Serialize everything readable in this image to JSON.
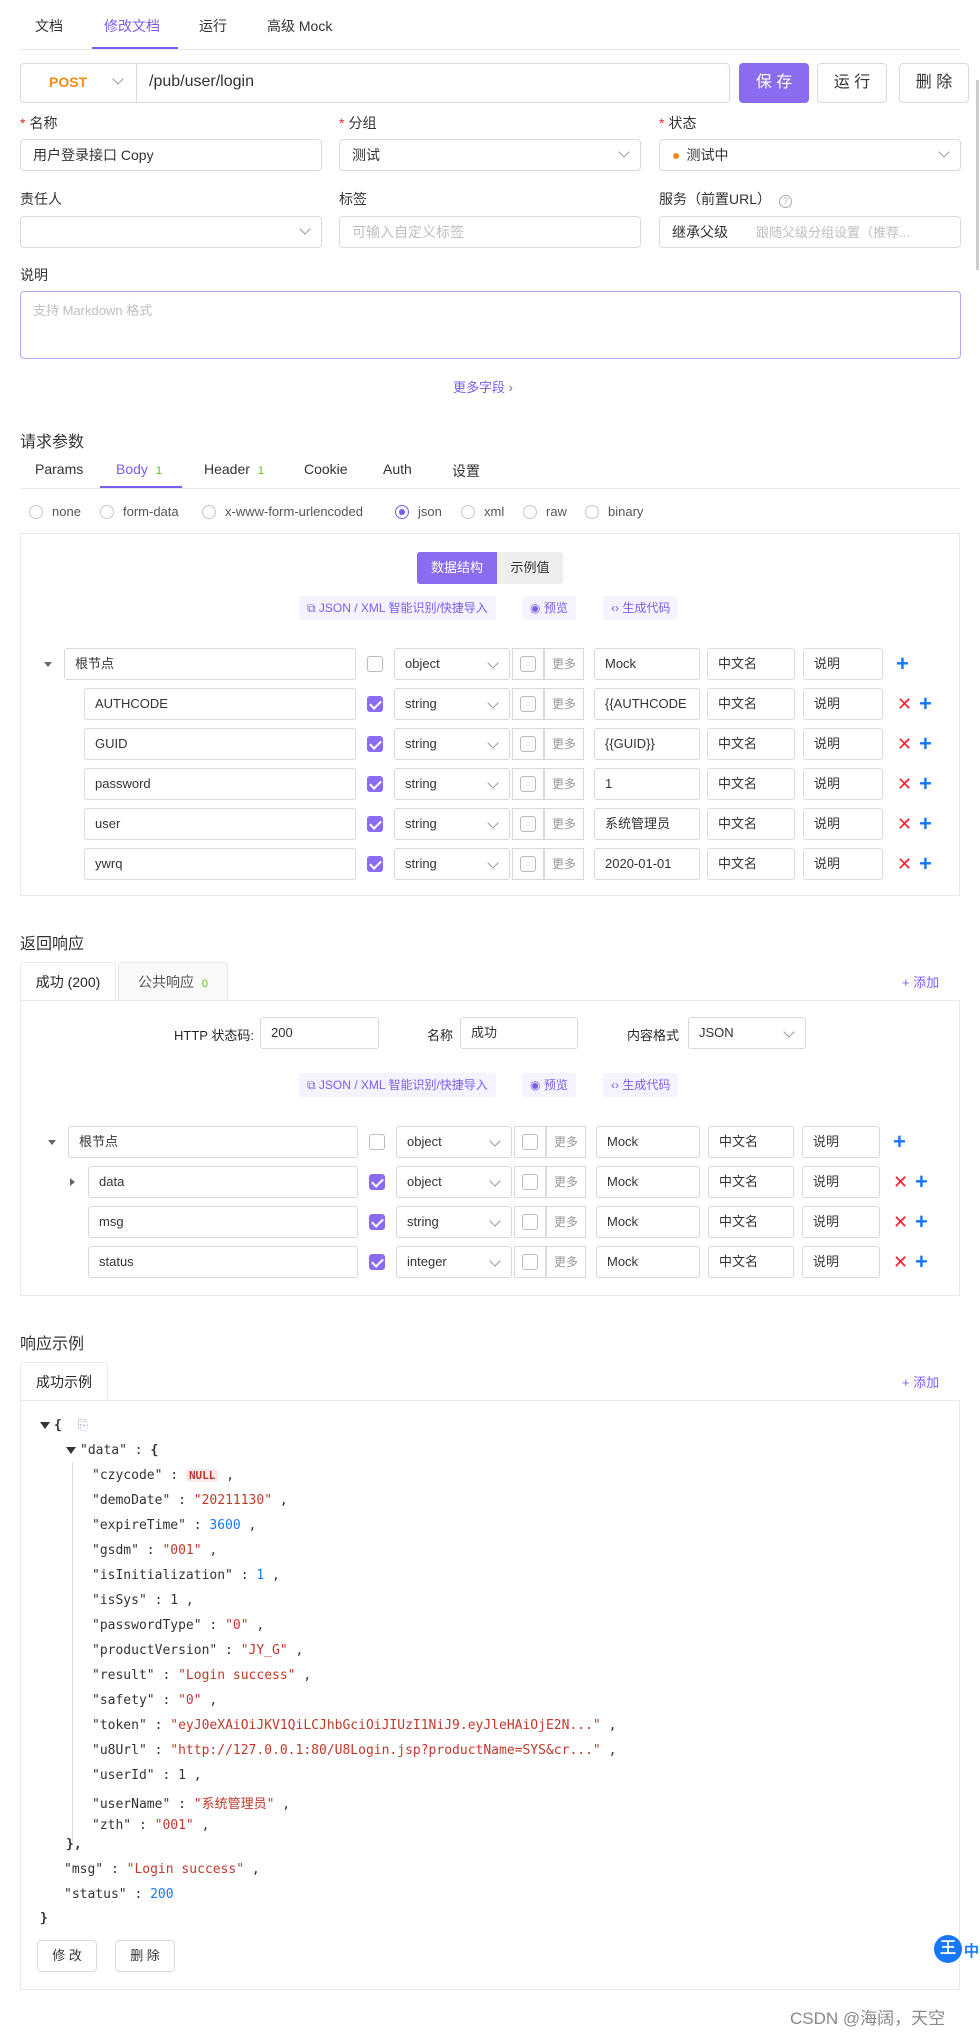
{
  "tabs": [
    "文档",
    "修改文档",
    "运行",
    "高级 Mock"
  ],
  "request": {
    "method": "POST",
    "path": "/pub/user/login",
    "save": "保 存",
    "run": "运 行",
    "delete": "删 除"
  },
  "form": {
    "name_label": "名称",
    "name_value": "用户登录接口 Copy",
    "group_label": "分组",
    "group_value": "测试",
    "status_label": "状态",
    "status_value": "测试中",
    "status_color": "#fa8c16",
    "owner_label": "责任人",
    "tag_label": "标签",
    "tag_placeholder": "可输入自定义标签",
    "service_label": "服务（前置URL）",
    "service_value": "继承父级",
    "service_hint": "跟随父级分组设置（推荐...",
    "desc_label": "说明",
    "desc_placeholder": "支持 Markdown 格式",
    "more_fields": "更多字段"
  },
  "req_params": {
    "title": "请求参数",
    "tabs": [
      {
        "label": "Params",
        "count": ""
      },
      {
        "label": "Body",
        "count": "1"
      },
      {
        "label": "Header",
        "count": "1"
      },
      {
        "label": "Cookie",
        "count": ""
      },
      {
        "label": "Auth",
        "count": ""
      },
      {
        "label": "设置",
        "count": ""
      }
    ],
    "body_types": [
      "none",
      "form-data",
      "x-www-form-urlencoded",
      "json",
      "xml",
      "raw",
      "binary"
    ],
    "seg_structure": "数据结构",
    "seg_example": "示例值",
    "link_import": "JSON / XML 智能识别/快捷导入",
    "link_preview": "预览",
    "link_code": "生成代码",
    "root": {
      "name": "根节点",
      "type": "object",
      "more": "更多",
      "mock": "Mock",
      "cn": "中文名",
      "desc": "说明"
    },
    "rows": [
      {
        "name": "AUTHCODE",
        "type": "string",
        "mock": "{{AUTHCODE"
      },
      {
        "name": "GUID",
        "type": "string",
        "mock": "{{GUID}}"
      },
      {
        "name": "password",
        "type": "string",
        "mock": "1"
      },
      {
        "name": "user",
        "type": "string",
        "mock": "系统管理员"
      },
      {
        "name": "ywrq",
        "type": "string",
        "mock": "2020-01-01"
      }
    ]
  },
  "resp": {
    "title": "返回响应",
    "tab_success": "成功 (200)",
    "tab_public": "公共响应",
    "public_count": "0",
    "add": "+ 添加",
    "http_label": "HTTP 状态码:",
    "http_value": "200",
    "name_label": "名称",
    "name_value": "成功",
    "fmt_label": "内容格式",
    "fmt_value": "JSON",
    "rows": [
      {
        "name": "data",
        "type": "object"
      },
      {
        "name": "msg",
        "type": "string"
      },
      {
        "name": "status",
        "type": "integer"
      }
    ]
  },
  "example": {
    "title": "响应示例",
    "tab": "成功示例",
    "add": "+ 添加",
    "edit": "修 改",
    "delete": "删 除",
    "data_fields": [
      {
        "k": "\"czycode\"",
        "v": "NULL",
        "t": "null"
      },
      {
        "k": "\"demoDate\"",
        "v": "\"20211130\"",
        "t": "s"
      },
      {
        "k": "\"expireTime\"",
        "v": "3600",
        "t": "n"
      },
      {
        "k": "\"gsdm\"",
        "v": "\"001\"",
        "t": "s"
      },
      {
        "k": "\"isInitialization\"",
        "v": "1",
        "t": "n"
      },
      {
        "k": "\"isSys\"",
        "v": "1",
        "t": "k"
      },
      {
        "k": "\"passwordType\"",
        "v": "\"0\"",
        "t": "s"
      },
      {
        "k": "\"productVersion\"",
        "v": "\"JY_G\"",
        "t": "s"
      },
      {
        "k": "\"result\"",
        "v": "\"Login success\"",
        "t": "s"
      },
      {
        "k": "\"safety\"",
        "v": "\"0\"",
        "t": "s"
      },
      {
        "k": "\"token\"",
        "v": "\"eyJ0eXAiOiJKV1QiLCJhbGciOiJIUzI1NiJ9.eyJleHAiOjE2N...\"",
        "t": "s"
      },
      {
        "k": "\"u8Url\"",
        "v": "\"http://127.0.0.1:80/U8Login.jsp?productName=SYS&cr...\"",
        "t": "s"
      },
      {
        "k": "\"userId\"",
        "v": "1",
        "t": "k"
      },
      {
        "k": "\"userName\"",
        "v": "\"系统管理员\"",
        "t": "s"
      },
      {
        "k": "\"zth\"",
        "v": "\"001\"",
        "t": "s"
      }
    ],
    "msg_key": "\"msg\"",
    "msg_val": "\"Login success\"",
    "status_key": "\"status\"",
    "status_val": "200",
    "data_key": "\"data\""
  },
  "watermark": "CSDN @海阔，天空",
  "float_badge": "中"
}
